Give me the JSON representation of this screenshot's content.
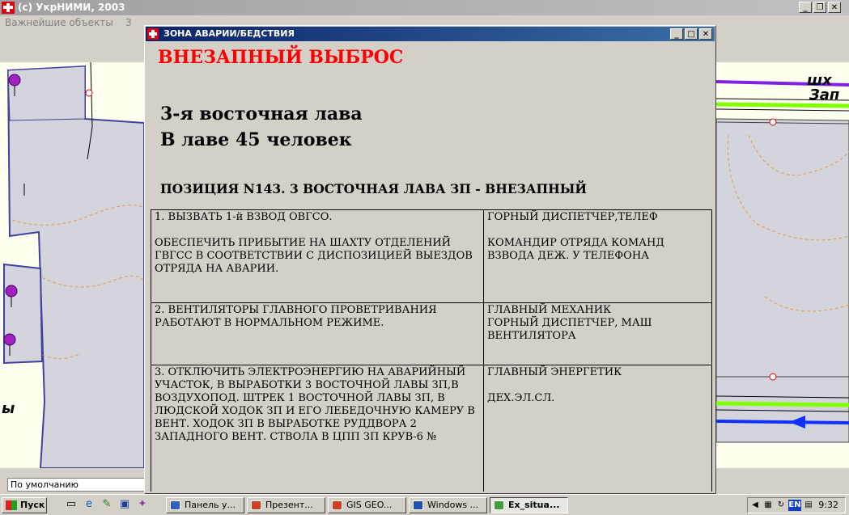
{
  "main_window": {
    "title": "(c) УкрНИМИ, 2003",
    "menu": [
      "Важнейшие объекты",
      "З"
    ]
  },
  "status": {
    "style_box": "По умолчанию"
  },
  "dialog": {
    "title": "ЗОНА АВАРИИ/БЕДСТВИЯ",
    "alarm_type": "ВНЕЗАПНЫЙ ВЫБРОС",
    "location": "3-я восточная лава",
    "people": "В лаве 45 человек",
    "position": "ПОЗИЦИЯ N143.  3 ВОСТОЧНАЯ ЛАВА ЗП - ВНЕЗАПНЫЙ",
    "rows": [
      {
        "action": "1. ВЫЗВАТЬ 1-й ВЗВОД ОВГСО.\n\nОБЕСПЕЧИТЬ ПРИБЫТИЕ НА ШАХТУ ОТДЕЛЕНИЙ ГВГСС В СООТВЕТСТВИИ С ДИСПОЗИЦИЕЙ ВЫЕЗДОВ ОТРЯДА НА АВАРИИ.",
        "responsible": "ГОРНЫЙ ДИСПЕТЧЕР,ТЕЛЕФ\n\nКОМАНДИР ОТРЯДА КОМАНД ВЗВОДА ДЕЖ. У ТЕЛЕФОНА"
      },
      {
        "action": "2. ВЕНТИЛЯТОРЫ ГЛАВНОГО ПРОВЕТРИВАНИЯ РАБОТАЮТ В НОРМАЛЬНОМ РЕЖИМЕ.",
        "responsible": "ГЛАВНЫЙ МЕХАНИК\nГОРНЫЙ ДИСПЕТЧЕР, МАШ\nВЕНТИЛЯТОРА"
      },
      {
        "action": "3. ОТКЛЮЧИТЬ ЭЛЕКТРОЭНЕРГИЮ НА АВАРИЙНЫЙ УЧАСТОК, В ВЫРАБОТКИ 3 ВОСТОЧНОЙ ЛАВЫ ЗП,В ВОЗДУХОПОД. ШТРЕК 1 ВОСТОЧНОЙ ЛАВЫ ЗП, В ЛЮДСКОЙ ХОДОК ЗП И ЕГО ЛЕБЕДОЧНУЮ КАМЕРУ В ВЕНТ. ХОДОК ЗП В ВЫРАБОТКЕ РУДДВОРА 2 ЗАПАДНОГО ВЕНТ. СТВОЛА В ЦПП ЗП КРУВ-6 №",
        "responsible": "ГЛАВНЫЙ ЭНЕРГЕТИК\n\nДЕХ.ЭЛ.СЛ."
      }
    ]
  },
  "map": {
    "label_1": "шх",
    "label_2": "Зап",
    "label_3": "ы"
  },
  "taskbar": {
    "start": "Пуск",
    "tasks": [
      "Панель у...",
      "Презент...",
      "GIS GEO...",
      "Windows ...",
      "Ex_situa..."
    ],
    "tray_lang": "EN",
    "clock": "9:32"
  }
}
